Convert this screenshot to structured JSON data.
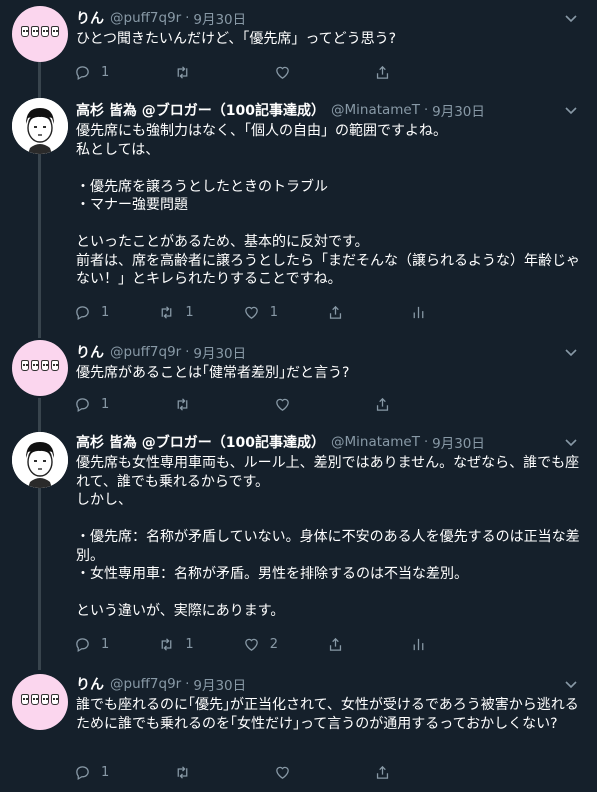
{
  "tweets": [
    {
      "name": "りん",
      "handle": "@puff7q9r",
      "sep": "·",
      "date": "9月30日",
      "text": "ひとつ聞きたいんだけど、「優先席」ってどう思う?",
      "reply_count": "1",
      "retweet_count": "",
      "like_count": "",
      "avatar": "rin"
    },
    {
      "name": "高杉 皆為 @ブロガー（100記事達成）",
      "handle": "@MinatameT",
      "sep": "·",
      "date": "9月30日",
      "text": "優先席にも強制力はなく、「個人の自由」の範囲ですよね。\n私としては、\n\n・優先席を譲ろうとしたときのトラブル\n・マナー強要問題\n\nといったことがあるため、基本的に反対です。\n前者は、席を高齢者に譲ろうとしたら「まだそんな（譲られるような）年齢じゃない！」とキレられたりすることですね。",
      "reply_count": "1",
      "retweet_count": "1",
      "like_count": "1",
      "avatar": "taka"
    },
    {
      "name": "りん",
      "handle": "@puff7q9r",
      "sep": "·",
      "date": "9月30日",
      "text": "優先席があることは｢健常者差別｣だと言う?",
      "reply_count": "1",
      "retweet_count": "",
      "like_count": "",
      "avatar": "rin"
    },
    {
      "name": "高杉 皆為 @ブロガー（100記事達成）",
      "handle": "@MinatameT",
      "sep": "·",
      "date": "9月30日",
      "text": "優先席も女性専用車両も、ルール上、差別ではありません。なぜなら、誰でも座れて、誰でも乗れるからです。\nしかし、\n\n・優先席：名称が矛盾していない。身体に不安のある人を優先するのは正当な差別。\n・女性専用車：名称が矛盾。男性を排除するのは不当な差別。\n\nという違いが、実際にあります。",
      "reply_count": "1",
      "retweet_count": "1",
      "like_count": "2",
      "avatar": "taka"
    },
    {
      "name": "りん",
      "handle": "@puff7q9r",
      "sep": "·",
      "date": "9月30日",
      "text": "誰でも座れるのに｢優先｣が正当化されて、女性が受けるであろう被害から逃れるために誰でも乗れるのを｢女性だけ｣って言うのが通用するっておかしくない?",
      "reply_count": "1",
      "retweet_count": "",
      "like_count": "",
      "avatar": "rin"
    }
  ],
  "colors": {
    "background": "#15202b",
    "text": "#ffffff",
    "muted": "#8899a6",
    "thread_line": "#38444d",
    "rin_avatar_bg": "#fbd6ee"
  },
  "icons": [
    "reply-icon",
    "retweet-icon",
    "like-icon",
    "share-icon",
    "analytics-icon",
    "chevron-down-icon"
  ]
}
